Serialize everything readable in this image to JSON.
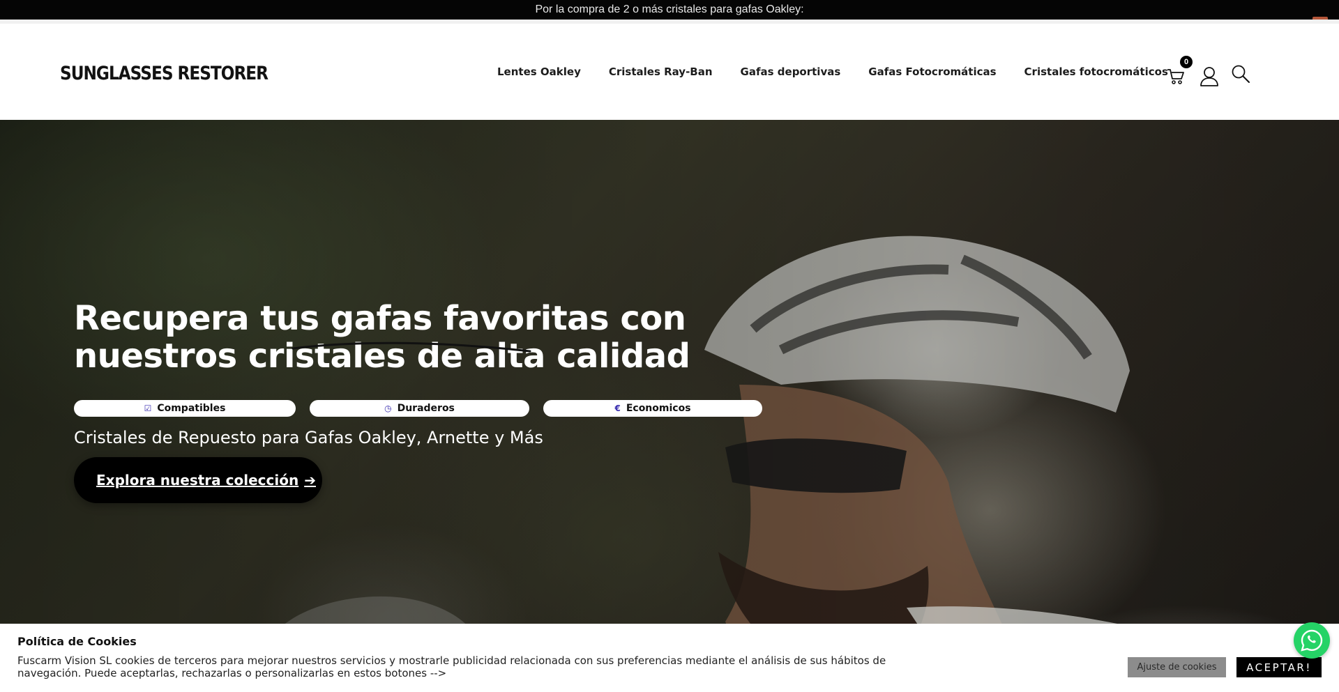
{
  "topbar": {
    "promo_text": "Por la compra de 2 o más cristales para gafas Oakley:"
  },
  "header": {
    "logo_text": "SUNGLASSES RESTORER",
    "nav": [
      {
        "label": "Lentes Oakley"
      },
      {
        "label": "Cristales Ray-Ban"
      },
      {
        "label": "Gafas deportivas"
      },
      {
        "label": "Gafas Fotocromáticas"
      },
      {
        "label": "Cristales fotocromáticos"
      }
    ],
    "cart_count": "0",
    "icons": [
      "cart-icon",
      "user-icon",
      "search-icon"
    ]
  },
  "hero": {
    "title": "Recupera tus gafas favoritas con nuestros cristales de alta calidad",
    "pills": [
      {
        "icon": "☑",
        "label": "Compatibles"
      },
      {
        "icon": "◷",
        "label": "Duraderos"
      },
      {
        "icon": "€",
        "label": "Economicos"
      }
    ],
    "subtitle": "Cristales de Repuesto para Gafas Oakley, Arnette y Más",
    "cta_label": "Explora nuestra colección",
    "cta_arrow": "➔"
  },
  "cookie_banner": {
    "title": "Política de Cookies",
    "text": "Fuscarm Vision SL cookies de terceros para mejorar nuestros servicios y mostrarle publicidad relacionada con sus preferencias mediante el análisis de sus hábitos de navegación. Puede aceptarlas, rechazarlas o personalizarlas en estos botones -->",
    "settings_label": "Ajuste de cookies",
    "accept_label": "ACEPTAR!"
  },
  "colors": {
    "topbar": "#050505",
    "accent_pill_icon": "#3b2fb0",
    "whatsapp": "#25d366",
    "cookie_settings": "#8c8c8c"
  }
}
